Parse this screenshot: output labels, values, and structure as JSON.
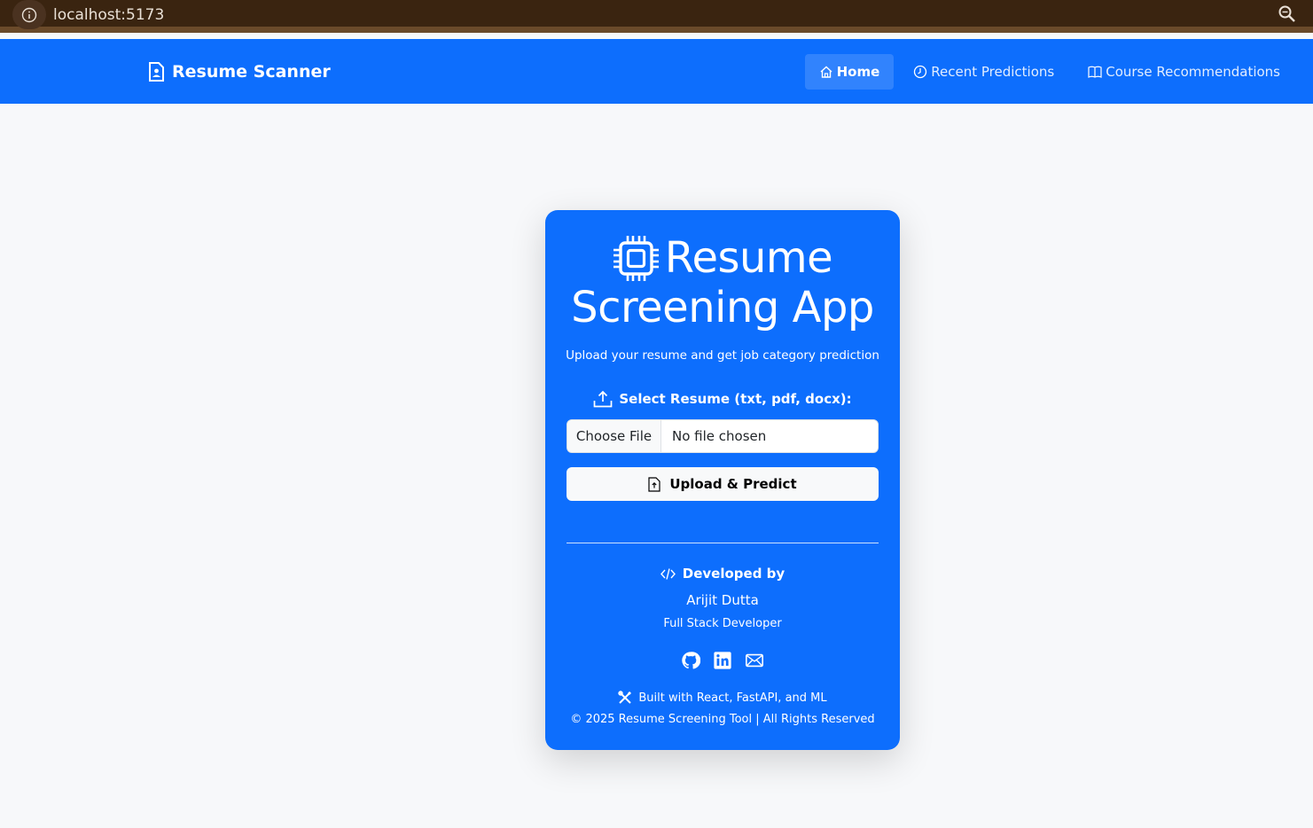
{
  "browser": {
    "url": "localhost:5173",
    "info_icon": "info-icon",
    "zoom_icon": "zoom-icon"
  },
  "navbar": {
    "brand": "Resume Scanner",
    "brand_icon": "document-person-icon",
    "links": [
      {
        "label": "Home",
        "icon": "house-icon",
        "active": true
      },
      {
        "label": "Recent Predictions",
        "icon": "clock-icon",
        "active": false
      },
      {
        "label": "Course Recommendations",
        "icon": "book-icon",
        "active": false
      }
    ]
  },
  "card": {
    "title_line1": "Resume",
    "title_line2": "Screening App",
    "title_icon": "cpu-chip-icon",
    "subtitle": "Upload your resume and get job category prediction",
    "select_label": "Select Resume (txt, pdf, docx):",
    "file_input": {
      "button": "Choose File",
      "status": "No file chosen"
    },
    "upload_button": "Upload & Predict",
    "developed_by": "Developed by",
    "developer_name": "Arijit Dutta",
    "developer_role": "Full Stack Developer",
    "socials": [
      "github-icon",
      "linkedin-icon",
      "mail-icon"
    ],
    "built_with": "Built with React, FastAPI, and ML",
    "copyright": "© 2025 Resume Screening Tool | All Rights Reserved"
  },
  "colors": {
    "primary": "#0d6efd",
    "background": "#f7f8fa",
    "browser_bar": "#3a2410"
  }
}
